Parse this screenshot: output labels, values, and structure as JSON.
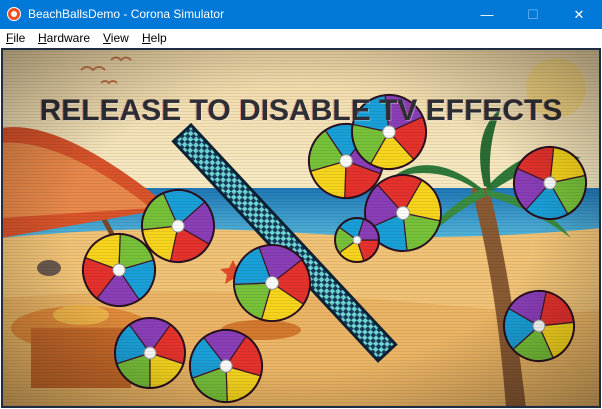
{
  "window": {
    "title": "BeachBallsDemo - Corona Simulator",
    "controls": {
      "minimize": "—",
      "maximize": "☐",
      "close": "✕"
    }
  },
  "menu": {
    "items": [
      {
        "mnemonic": "F",
        "rest": "ile"
      },
      {
        "mnemonic": "H",
        "rest": "ardware"
      },
      {
        "mnemonic": "V",
        "rest": "iew"
      },
      {
        "mnemonic": "H",
        "rest": "elp"
      }
    ]
  },
  "scene": {
    "overlay_text": "RELEASE TO DISABLE TV EFFECTS",
    "icons": {
      "app": "corona-app-icon",
      "balls": "beach-ball-icon",
      "bar": "checkered-bar",
      "umbrella": "beach-umbrella",
      "palm": "palm-tree",
      "sun": "sun",
      "birds": "seagulls"
    },
    "colors": {
      "titlebar": "#0078d7",
      "sky": "#f5e1a8",
      "sea": "#2f8fc6",
      "sand": "#f1c377",
      "umbrella_red": "#d9542b",
      "ball_red": "#e5322d",
      "ball_yellow": "#f7d51d",
      "ball_green": "#78c23a",
      "ball_blue": "#1aa0d8",
      "ball_purple": "#8a3fb8",
      "bar_light": "#6fd8d6",
      "bar_dark": "#173c5a"
    }
  }
}
